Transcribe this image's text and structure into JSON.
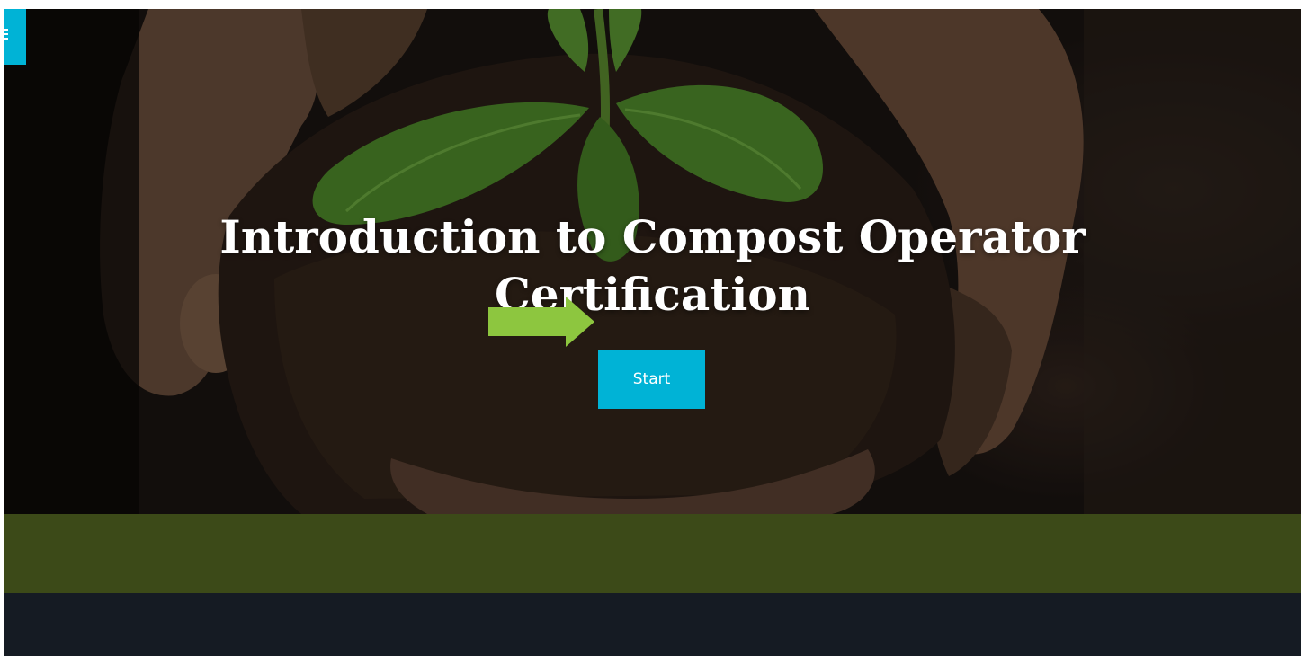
{
  "hero": {
    "title": "Introduction to Compost Operator Certification",
    "start_label": "Start",
    "background_image": "hands-holding-soil-with-seedling"
  },
  "menu": {
    "icon": "hamburger-menu-icon"
  },
  "pointer": {
    "icon": "arrow-right-icon"
  },
  "colors": {
    "accent": "#00b3d6",
    "arrow": "#8dc63f",
    "band_green": "#3c4a18",
    "band_dark": "#151b23"
  }
}
